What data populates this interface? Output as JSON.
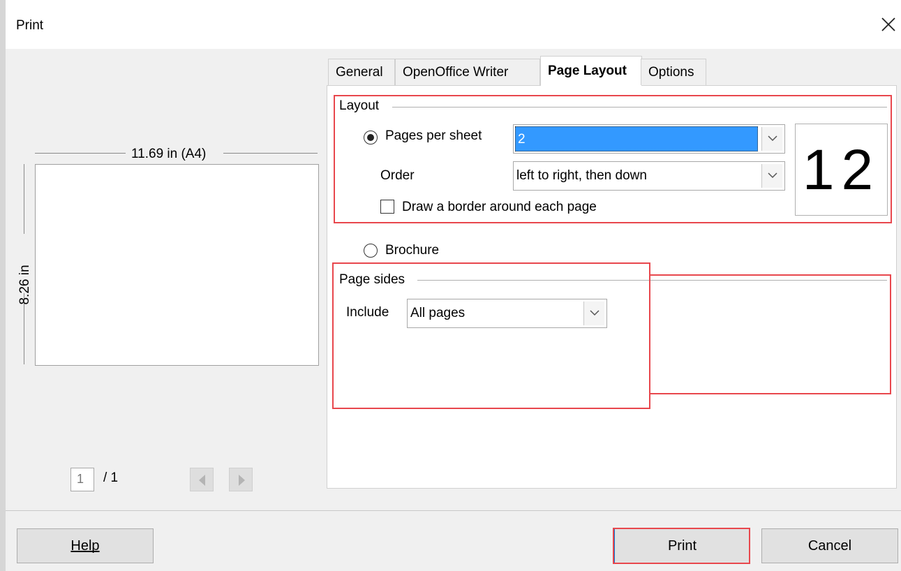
{
  "window": {
    "title": "Print"
  },
  "preview": {
    "width_label": "11.69 in (A4)",
    "height_label": "8.26 in",
    "page_number": "1",
    "page_total": "/ 1"
  },
  "tabs": [
    {
      "label": "General"
    },
    {
      "label": "OpenOffice Writer"
    },
    {
      "label": "Page Layout",
      "active": true
    },
    {
      "label": "Options"
    }
  ],
  "layout": {
    "group_title": "Layout",
    "pages_per_sheet_label": "Pages per sheet",
    "pages_per_sheet_value": "2",
    "order_label": "Order",
    "order_value": "left to right, then down",
    "border_label": "Draw a border around each page",
    "preview_numbers": "12",
    "brochure_label": "Brochure"
  },
  "page_sides": {
    "group_title": "Page sides",
    "include_label": "Include",
    "include_value": "All pages"
  },
  "buttons": {
    "help": "Help",
    "print": "Print",
    "cancel": "Cancel"
  },
  "colors": {
    "selection": "#3399ff",
    "highlight_annotation": "#e8474d"
  }
}
